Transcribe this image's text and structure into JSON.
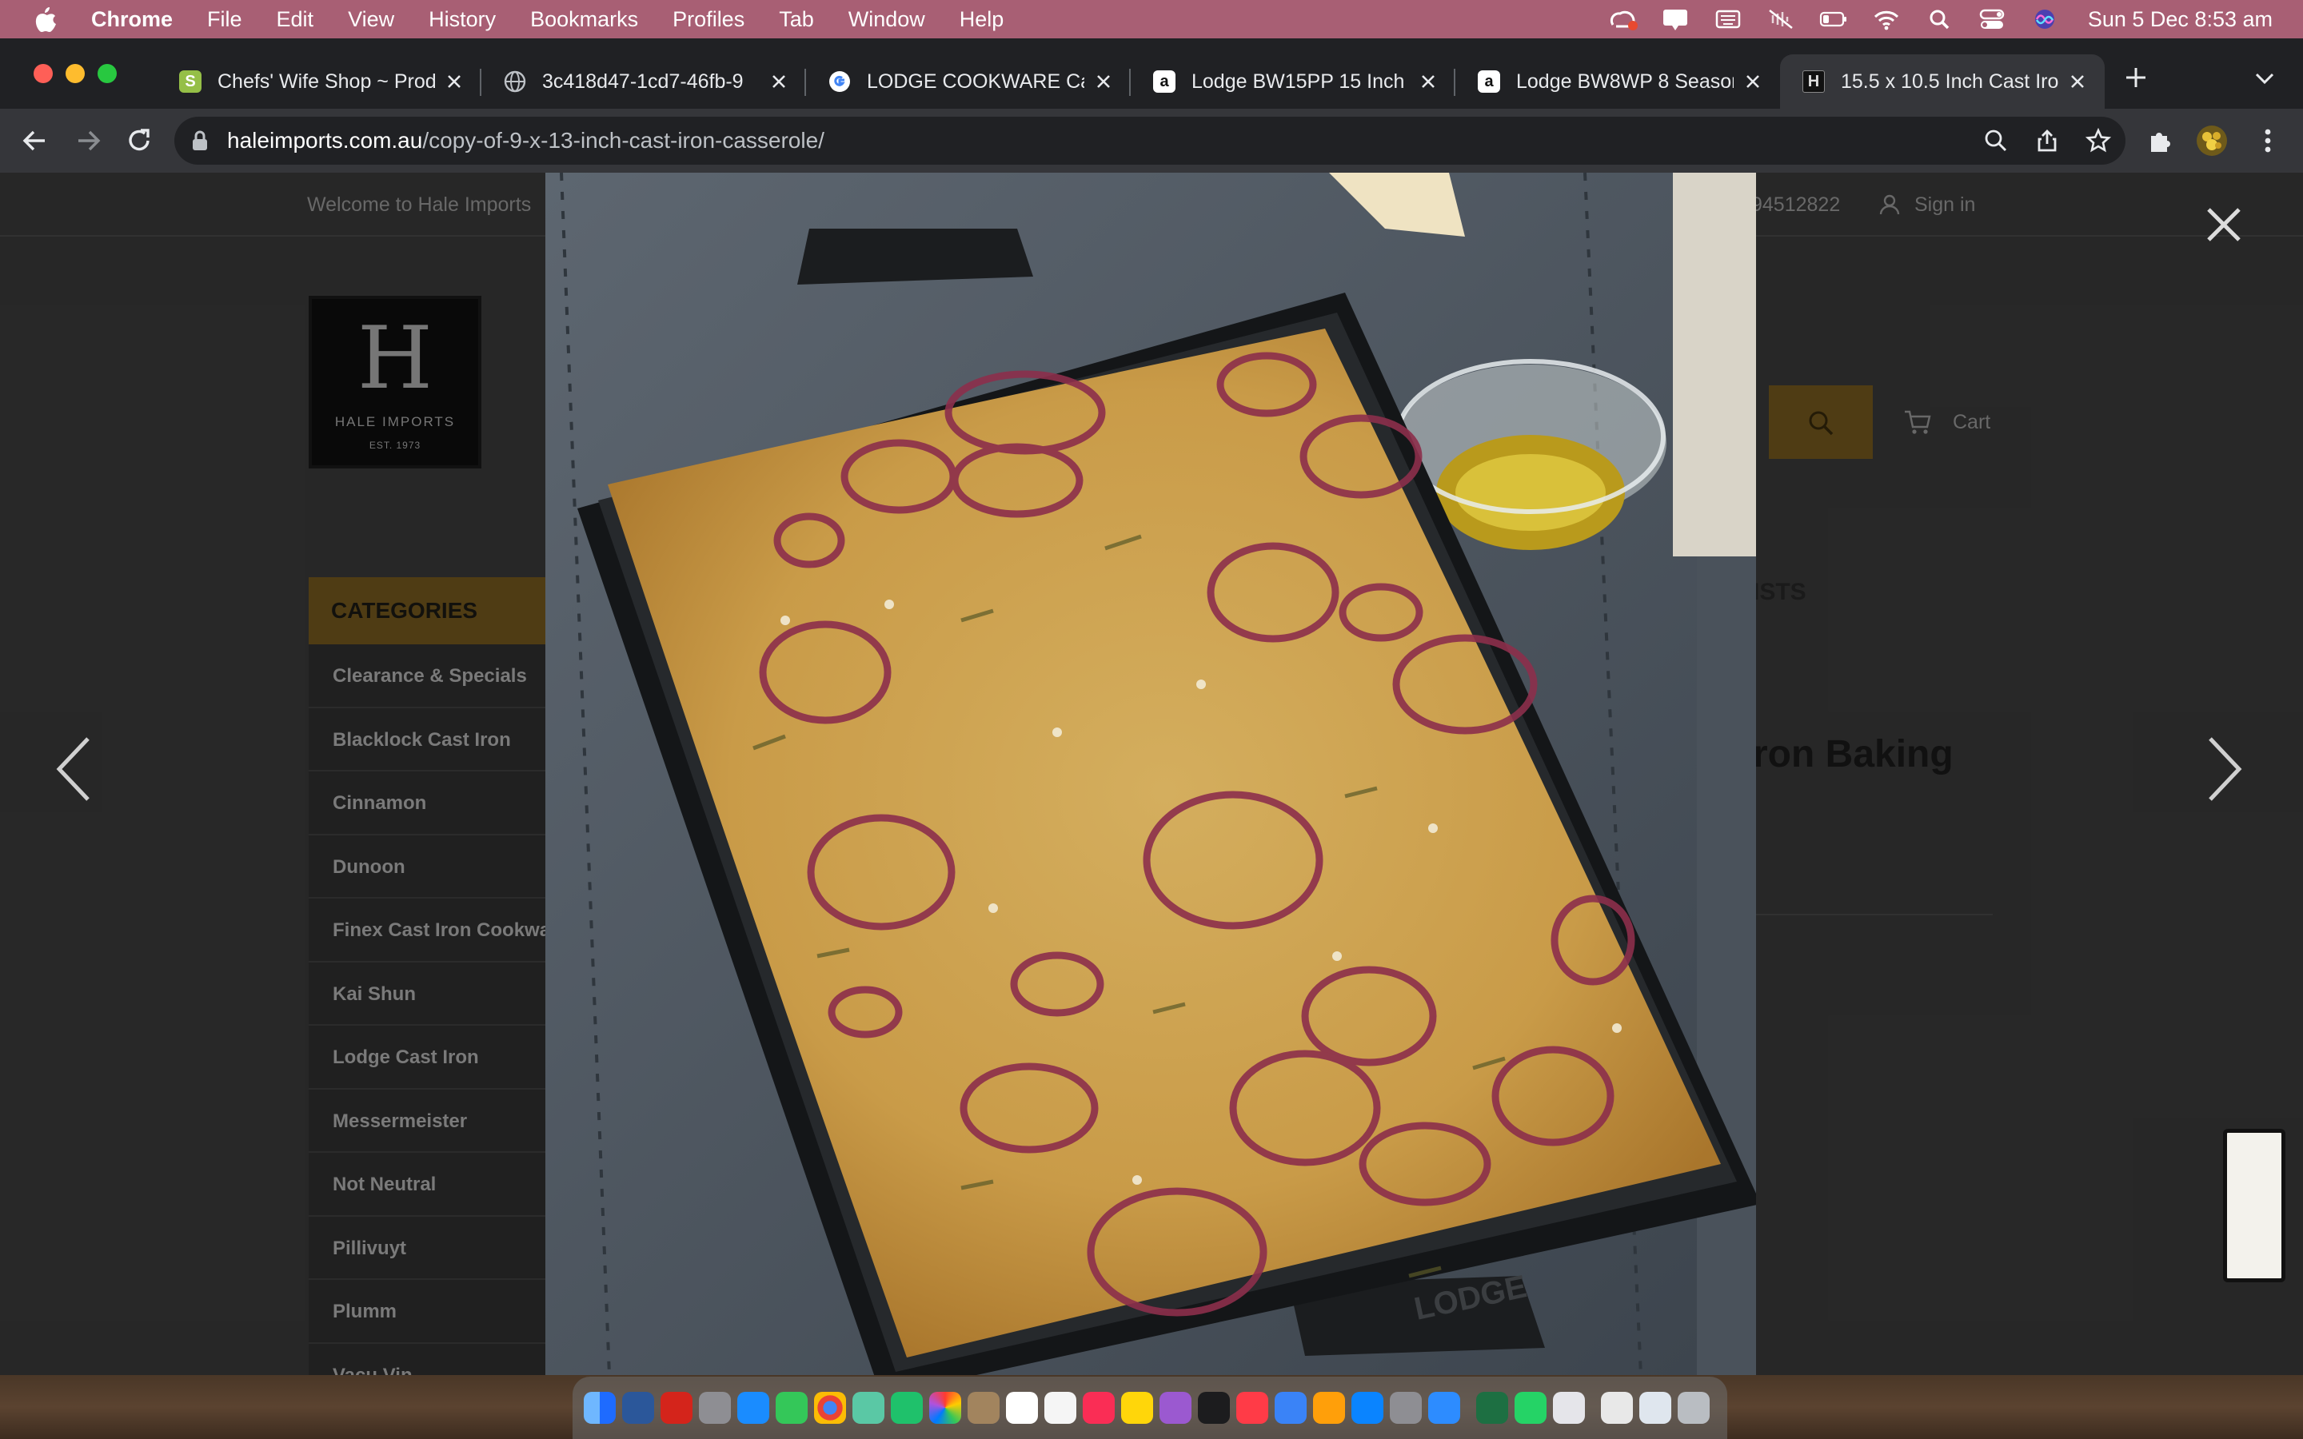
{
  "menubar": {
    "items": [
      "Chrome",
      "File",
      "Edit",
      "View",
      "History",
      "Bookmarks",
      "Profiles",
      "Tab",
      "Window",
      "Help"
    ],
    "clock": "Sun 5 Dec  8:53 am"
  },
  "tabs": [
    {
      "title": "Chefs' Wife Shop ~ Prod",
      "favicon": "shopify-icon"
    },
    {
      "title": "3c418d47-1cd7-46fb-9",
      "favicon": "globe-icon"
    },
    {
      "title": "LODGE COOKWARE Cas",
      "favicon": "google-icon"
    },
    {
      "title": "Lodge BW15PP 15 Inch S",
      "favicon": "amazon-icon"
    },
    {
      "title": "Lodge BW8WP 8 Seasor",
      "favicon": "amazon-icon"
    },
    {
      "title": "15.5 x 10.5 Inch Cast Iro",
      "favicon": "hale-imports-icon"
    }
  ],
  "address": {
    "host": "haleimports.com.au",
    "path": "/copy-of-9-x-13-inch-cast-iron-casserole/"
  },
  "page": {
    "welcome": "Welcome to Hale Imports",
    "phone": "94512822",
    "signin": "Sign in",
    "cart": "Cart",
    "logo": {
      "letter": "H",
      "name": "HALE IMPORTS",
      "est": "EST. 1973"
    },
    "categories_title": "CATEGORIES",
    "categories": [
      "Clearance & Specials",
      "Blacklock Cast Iron",
      "Cinnamon",
      "Dunoon",
      "Finex Cast Iron Cookware",
      "Kai Shun",
      "Lodge Cast Iron",
      "Messermeister",
      "Not Neutral",
      "Pillivuyt",
      "Plumm",
      "Vacu Vin"
    ],
    "nav_partial": "ISTS",
    "title_partial": "ron Baking"
  },
  "photo": {
    "pan_brand": "LODGE"
  },
  "colors": {
    "menubar": "#a85f74",
    "accent": "#5c4618",
    "tab_strip": "#202124",
    "toolbar": "#35363a"
  }
}
